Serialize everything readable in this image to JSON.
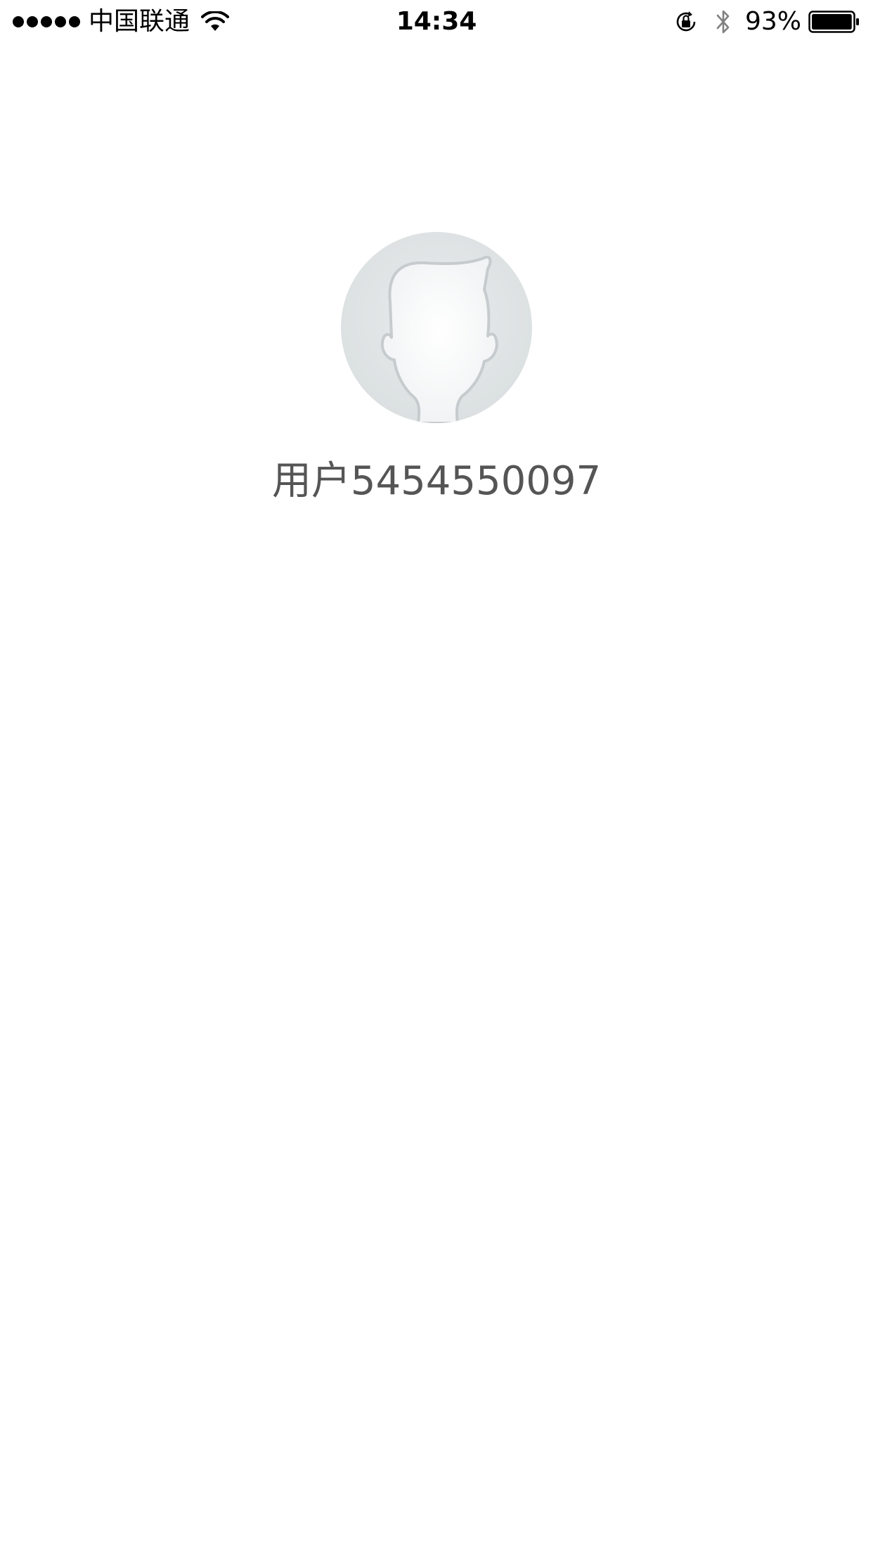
{
  "status_bar": {
    "carrier": "中国联通",
    "time": "14:34",
    "battery_percent": "93%",
    "battery_level": 0.93,
    "icons": [
      "signal-dots",
      "wifi-icon",
      "rotation-lock-icon",
      "bluetooth-icon",
      "battery-icon"
    ]
  },
  "profile": {
    "username": "用户5454550097",
    "avatar_icon": "default-avatar-icon"
  },
  "colors": {
    "background": "#ffffff",
    "username_text": "#555555",
    "avatar_bg": "#dfe3e4",
    "status_text": "#000000"
  }
}
